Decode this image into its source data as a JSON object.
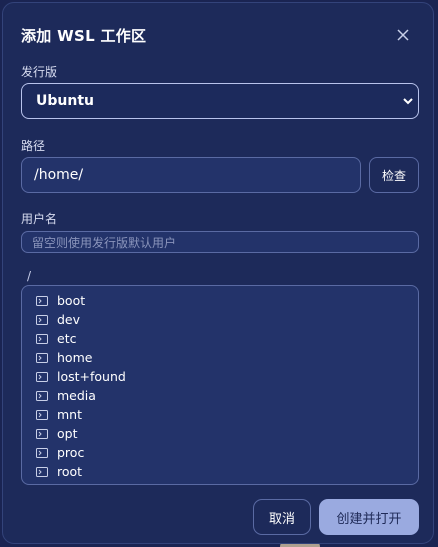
{
  "dialog": {
    "title": "添加 WSL 工作区",
    "distro_label": "发行版",
    "distro_value": "Ubuntu",
    "path_label": "路径",
    "path_value": "/home/",
    "check_label": "检查",
    "username_label": "用户名",
    "username_placeholder": "留空则使用发行版默认用户",
    "current_dir": "/",
    "entries": [
      "boot",
      "dev",
      "etc",
      "home",
      "lost+found",
      "media",
      "mnt",
      "opt",
      "proc",
      "root"
    ],
    "cancel_label": "取消",
    "create_label": "创建并打开"
  },
  "icons": {
    "close": "close-icon",
    "dropdown": "chevron-down-icon",
    "folder": "terminal-folder-icon"
  },
  "colors": {
    "background": "#1a2452",
    "dialog": "#1d2a5a",
    "input": "#23336a",
    "border": "#5a6aa3",
    "primary_button": "#9aaae0"
  }
}
